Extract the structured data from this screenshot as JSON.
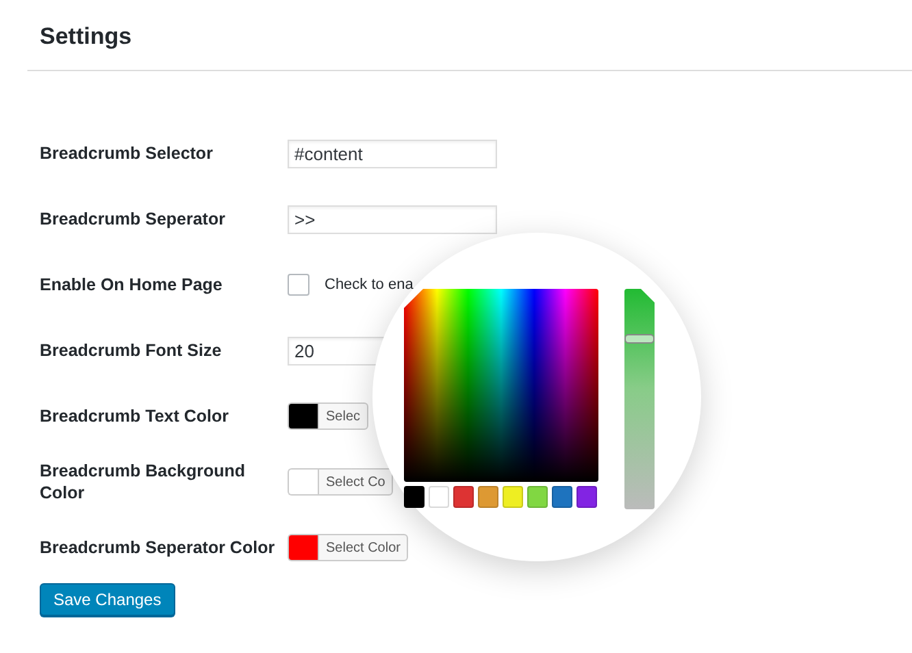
{
  "page": {
    "title": "Settings"
  },
  "fields": [
    {
      "kind": "text",
      "label": "Breadcrumb Selector",
      "value": "#content"
    },
    {
      "kind": "text",
      "label": "Breadcrumb Seperator",
      "value": ">>"
    },
    {
      "kind": "checkbox",
      "label": "Enable On Home Page",
      "checked": false,
      "description": "Check to ena"
    },
    {
      "kind": "text",
      "label": "Breadcrumb Font Size",
      "value": "20"
    },
    {
      "kind": "color",
      "label": "Breadcrumb Text Color",
      "color": "#000000",
      "button": "Selec"
    },
    {
      "kind": "color",
      "label": "Breadcrumb Background Color",
      "color": "#ffffff",
      "button": "Select Co"
    },
    {
      "kind": "color",
      "label": "Breadcrumb Seperator Color",
      "color": "#ff0000",
      "button": "Select Color"
    }
  ],
  "save_button": "Save Changes",
  "color_picker": {
    "swatches": [
      {
        "color": "#000000"
      },
      {
        "color": "#ffffff"
      },
      {
        "color": "#dd3333"
      },
      {
        "color": "#dd9933"
      },
      {
        "color": "#eeee22"
      },
      {
        "color": "#81d742"
      },
      {
        "color": "#1e73be"
      },
      {
        "color": "#8224e3"
      }
    ],
    "slider": {
      "level": 0.77
    }
  }
}
